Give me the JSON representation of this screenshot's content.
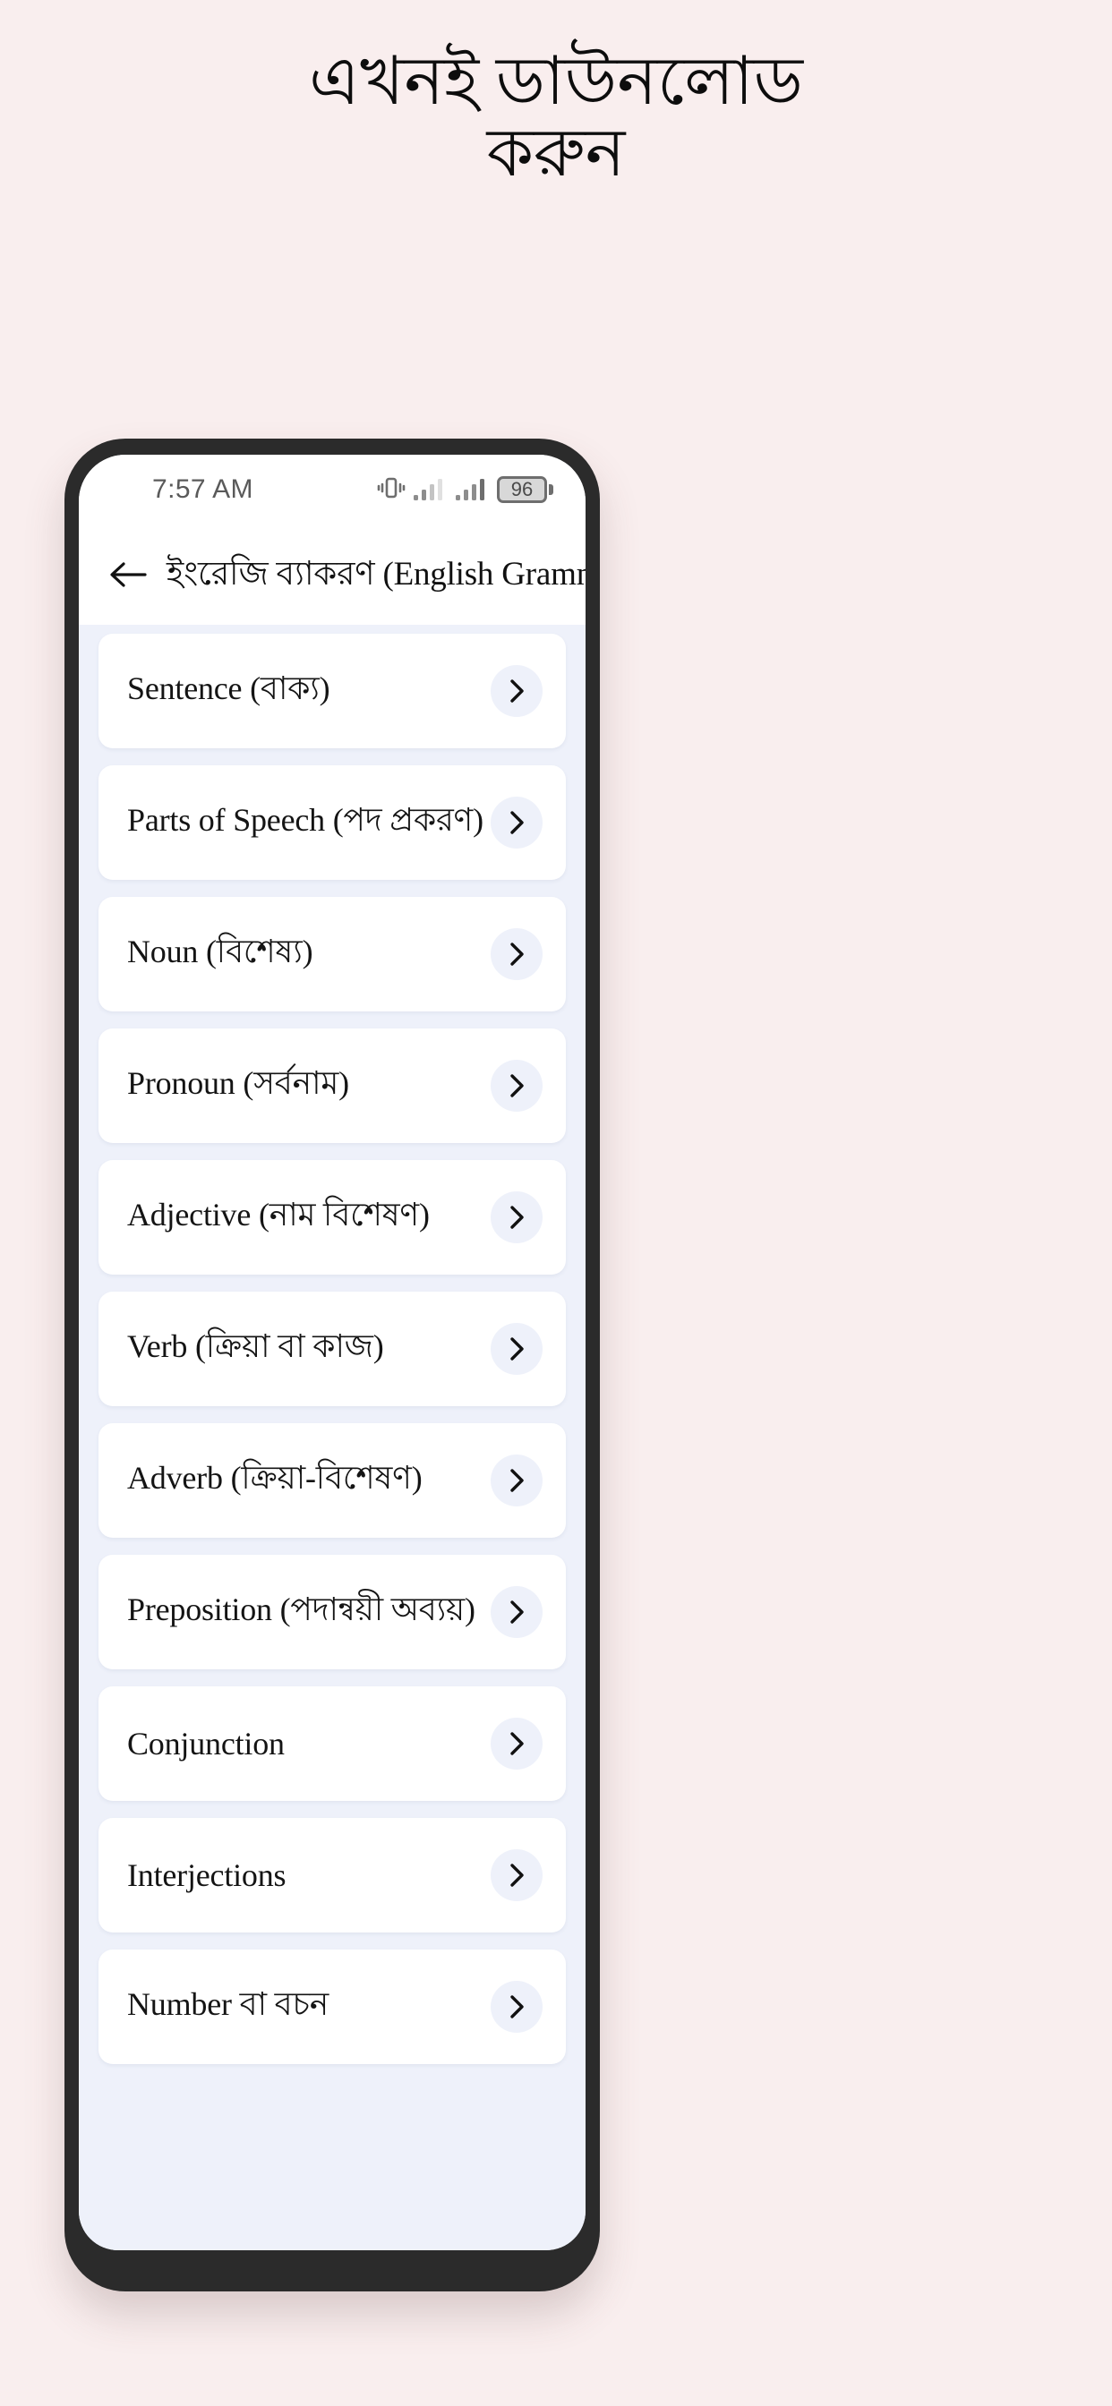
{
  "promo": {
    "heading_line1": "এখনই ডাউনলোড",
    "heading_line2": "করুন",
    "background_color": "#f9eeee"
  },
  "phone": {
    "bezel_color": "#2b2b2b",
    "screen_background": "#eef1fa"
  },
  "status_bar": {
    "time": "7:57 AM",
    "battery_percent": "96",
    "icons": [
      "vibrate-icon",
      "signal-bars-icon",
      "signal-bars-icon",
      "battery-icon"
    ]
  },
  "app_bar": {
    "back_icon": "arrow-left-icon",
    "title": "ইংরেজি ব্যাকরণ (English Grammar)",
    "background_color": "#ffffff"
  },
  "list": {
    "chevron_icon": "chevron-right-icon",
    "items": [
      {
        "label": "Sentence (বাক্য)"
      },
      {
        "label": "Parts of Speech (পদ প্রকরণ)"
      },
      {
        "label": "Noun (বিশেষ্য)"
      },
      {
        "label": "Pronoun (সর্বনাম)"
      },
      {
        "label": "Adjective (নাম বিশেষণ)"
      },
      {
        "label": "Verb (ক্রিয়া বা কাজ)"
      },
      {
        "label": "Adverb (ক্রিয়া-বিশেষণ)"
      },
      {
        "label": "Preposition (পদান্বয়ী অব্যয়)"
      },
      {
        "label": "Conjunction"
      },
      {
        "label": "Interjections"
      },
      {
        "label": "Number বা বচন"
      }
    ]
  }
}
